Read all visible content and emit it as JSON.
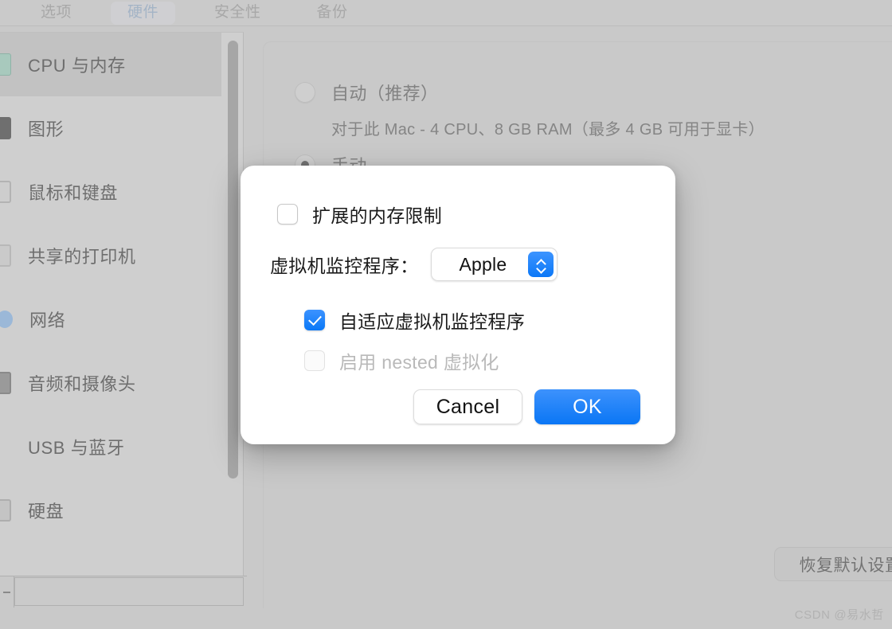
{
  "tabs": [
    {
      "label": "选项",
      "selected": false
    },
    {
      "label": "硬件",
      "selected": true
    },
    {
      "label": "安全性",
      "selected": false
    },
    {
      "label": "备份",
      "selected": false
    }
  ],
  "sidebar": {
    "items": [
      {
        "label": "CPU 与内存",
        "icon": "cpu-memory-icon",
        "selected": true
      },
      {
        "label": "图形",
        "icon": "graphics-icon",
        "selected": false
      },
      {
        "label": "鼠标和键盘",
        "icon": "mouse-keyboard-icon",
        "selected": false
      },
      {
        "label": "共享的打印机",
        "icon": "shared-printer-icon",
        "selected": false
      },
      {
        "label": "网络",
        "icon": "network-icon",
        "selected": false
      },
      {
        "label": "音频和摄像头",
        "icon": "audio-camera-icon",
        "selected": false
      },
      {
        "label": "USB 与蓝牙",
        "icon": "usb-bluetooth-icon",
        "selected": false
      },
      {
        "label": "硬盘",
        "icon": "hard-disk-icon",
        "selected": false
      }
    ]
  },
  "bottom_toolbar": {
    "remove_icon": "minus-icon"
  },
  "main": {
    "memory_mode": {
      "auto_label": "自动（推荐）",
      "auto_selected": false,
      "auto_description": "对于此 Mac - 4 CPU、8 GB RAM（最多 4 GB 可用于显卡）",
      "manual_label": "手动",
      "manual_selected": true
    },
    "restore_defaults_label": "恢复默认设置"
  },
  "dialog": {
    "extended_memory_limit": {
      "label": "扩展的内存限制",
      "checked": false,
      "disabled": false
    },
    "hypervisor": {
      "label": "虚拟机监控程序：",
      "value": "Apple",
      "stepper_icon": "up-down-chevron-icon"
    },
    "adaptive_hypervisor": {
      "label": "自适应虚拟机监控程序",
      "checked": true,
      "disabled": false
    },
    "nested_virtualization": {
      "label": "启用 nested 虚拟化",
      "checked": false,
      "disabled": true
    },
    "cancel_label": "Cancel",
    "ok_label": "OK"
  },
  "watermark": "CSDN @易水哲",
  "colors": {
    "accent_blue": "#0a76f5",
    "window_gray": "#c9c9c9",
    "sidebar_gray": "#cfcfcf",
    "selected_row_gray": "#c2c2c2",
    "tab_selected_text": "#a4b4c6"
  }
}
